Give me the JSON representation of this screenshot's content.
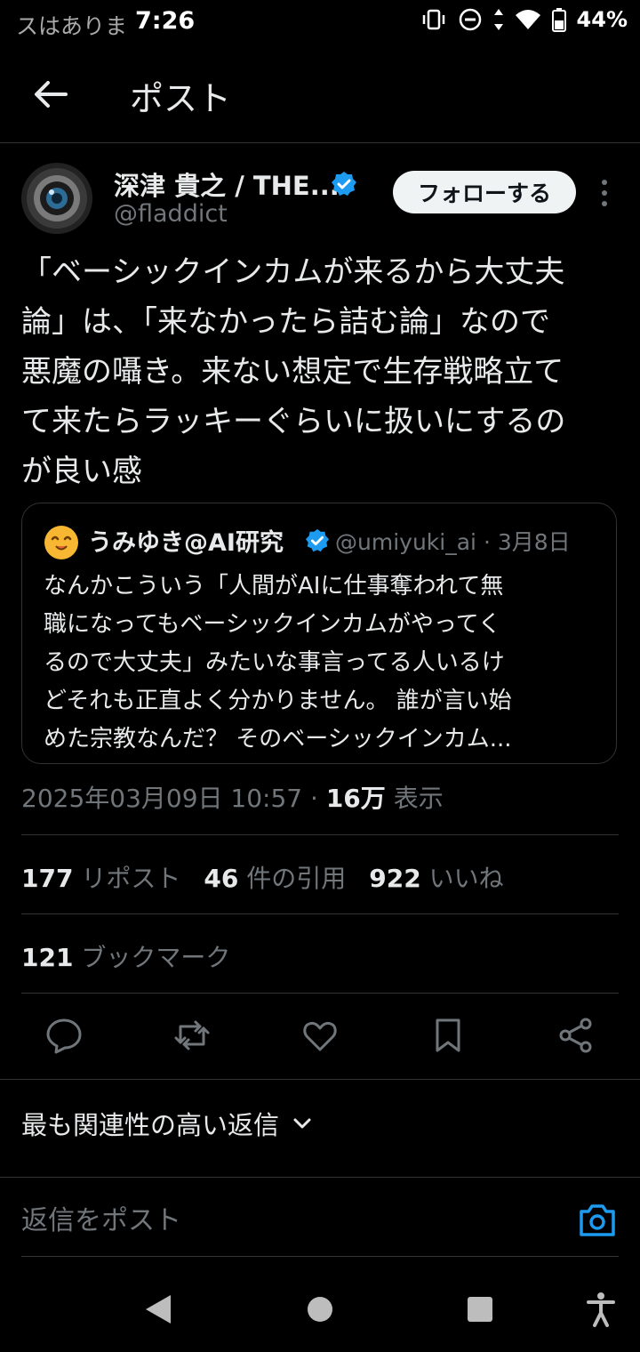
{
  "status_bar": {
    "notification_preview": "スはありま",
    "time": "7:26",
    "battery": "44%"
  },
  "header": {
    "title": "ポスト"
  },
  "author": {
    "name": "深津 貴之 / THE...",
    "handle": "@fladdict",
    "follow_label": "フォローする"
  },
  "tweet": {
    "text": "「ベーシックインカムが来るから大丈夫\n論」は、「来なかったら詰む論」なので\n悪魔の囁き。来ない想定で生存戦略立て\nて来たらラッキーぐらいに扱いにするの\nが良い感"
  },
  "quote": {
    "name": "うみゆき@AI研究",
    "handle": "@umiyuki_ai",
    "date": "3月8日",
    "text": "なんかこういう「人間がAIに仕事奪われて無\n職になってもベーシックインカムがやってく\nるので大丈夫」みたいな事言ってる人いるけ\nどそれも正直よく分かりません。 誰が言い始\nめた宗教なんだ？ そのベーシックインカム..."
  },
  "meta": {
    "timestamp": "2025年03月09日 10:57",
    "separator": " · ",
    "views_count": "16万",
    "views_label": "表示"
  },
  "stats": {
    "reposts_count": "177",
    "reposts_label": "リポスト",
    "quotes_count": "46",
    "quotes_label": "件の引用",
    "likes_count": "922",
    "likes_label": "いいね",
    "bookmarks_count": "121",
    "bookmarks_label": "ブックマーク"
  },
  "replies": {
    "sort_label": "最も関連性の高い返信",
    "input_placeholder": "返信をポスト"
  },
  "colors": {
    "background": "#000000",
    "text": "#e7e9ea",
    "muted": "#71767b",
    "divider": "#2f3336",
    "accent": "#1d9bf0"
  }
}
